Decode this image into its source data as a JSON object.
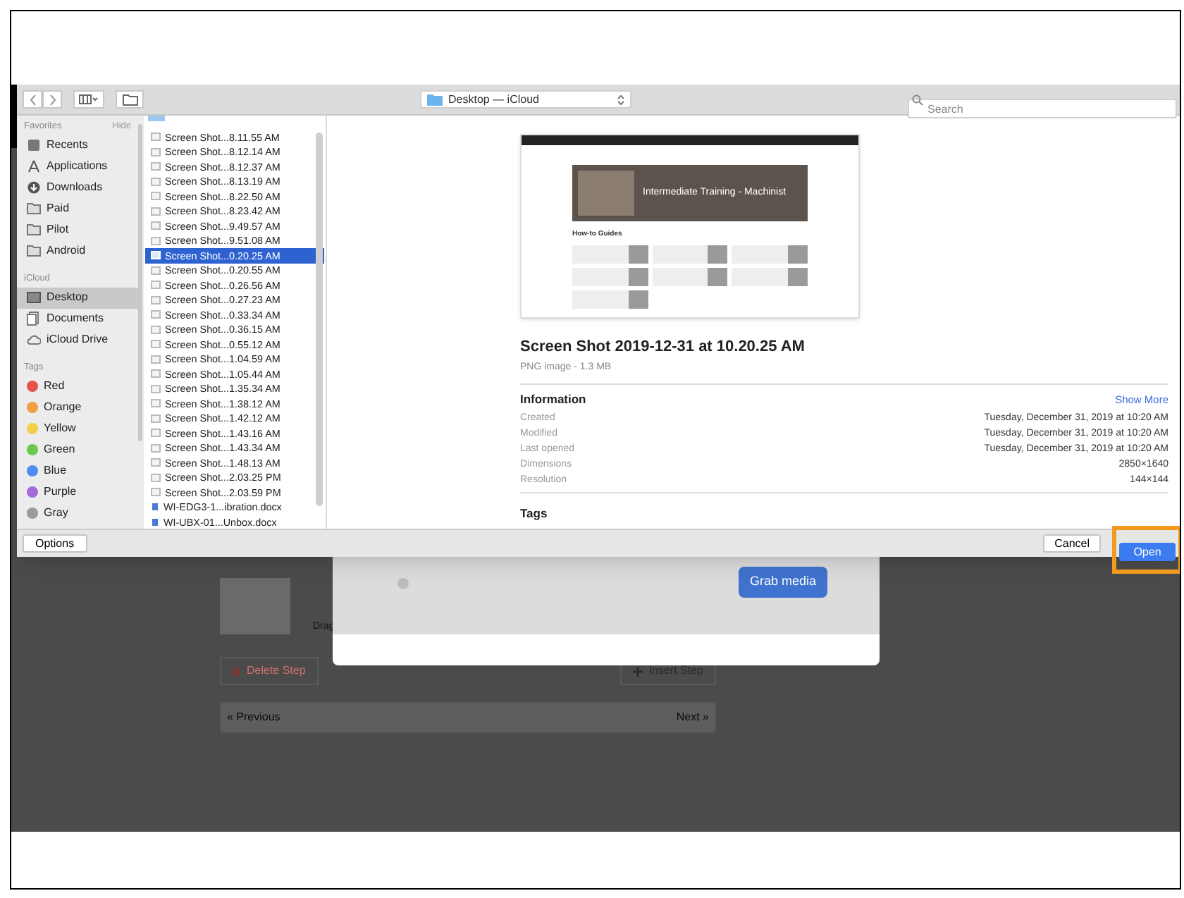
{
  "toolbar": {
    "location": "Desktop — iCloud",
    "search": {
      "placeholder": "Search"
    }
  },
  "sidebar": {
    "sections": [
      {
        "title": "Favorites",
        "action": "Hide",
        "items": [
          {
            "label": "Recents",
            "selected": false
          },
          {
            "label": "Applications",
            "selected": false
          },
          {
            "label": "Downloads",
            "selected": false
          },
          {
            "label": "Paid",
            "selected": false
          },
          {
            "label": "Pilot",
            "selected": false
          },
          {
            "label": "Android",
            "selected": false
          }
        ]
      },
      {
        "title": "iCloud",
        "items": [
          {
            "label": "Desktop",
            "selected": true
          },
          {
            "label": "Documents",
            "selected": false
          },
          {
            "label": "iCloud Drive",
            "selected": false
          }
        ]
      },
      {
        "title": "Tags",
        "items": [
          {
            "label": "Red",
            "color": "#e5534b",
            "selected": false
          },
          {
            "label": "Orange",
            "color": "#f0a040",
            "selected": false
          },
          {
            "label": "Yellow",
            "color": "#f2d04a",
            "selected": false
          },
          {
            "label": "Green",
            "color": "#6cc94f",
            "selected": false
          },
          {
            "label": "Blue",
            "color": "#4f8cf5",
            "selected": false
          },
          {
            "label": "Purple",
            "color": "#a66ad8",
            "selected": false
          },
          {
            "label": "Gray",
            "color": "#9a9a9a",
            "selected": false
          }
        ]
      }
    ]
  },
  "files": [
    {
      "name": "Screen Shot...8.11.55 AM",
      "kind": "image",
      "selected": false
    },
    {
      "name": "Screen Shot...8.12.14 AM",
      "kind": "image",
      "selected": false
    },
    {
      "name": "Screen Shot...8.12.37 AM",
      "kind": "image",
      "selected": false
    },
    {
      "name": "Screen Shot...8.13.19 AM",
      "kind": "image",
      "selected": false
    },
    {
      "name": "Screen Shot...8.22.50 AM",
      "kind": "image",
      "selected": false
    },
    {
      "name": "Screen Shot...8.23.42 AM",
      "kind": "image",
      "selected": false
    },
    {
      "name": "Screen Shot...9.49.57 AM",
      "kind": "image",
      "selected": false
    },
    {
      "name": "Screen Shot...9.51.08 AM",
      "kind": "image",
      "selected": false
    },
    {
      "name": "Screen Shot...0.20.25 AM",
      "kind": "image",
      "selected": true
    },
    {
      "name": "Screen Shot...0.20.55 AM",
      "kind": "image",
      "selected": false
    },
    {
      "name": "Screen Shot...0.26.56 AM",
      "kind": "image",
      "selected": false
    },
    {
      "name": "Screen Shot...0.27.23 AM",
      "kind": "image",
      "selected": false
    },
    {
      "name": "Screen Shot...0.33.34 AM",
      "kind": "image",
      "selected": false
    },
    {
      "name": "Screen Shot...0.36.15 AM",
      "kind": "image",
      "selected": false
    },
    {
      "name": "Screen Shot...0.55.12 AM",
      "kind": "image",
      "selected": false
    },
    {
      "name": "Screen Shot...1.04.59 AM",
      "kind": "image",
      "selected": false
    },
    {
      "name": "Screen Shot...1.05.44 AM",
      "kind": "image",
      "selected": false
    },
    {
      "name": "Screen Shot...1.35.34 AM",
      "kind": "image",
      "selected": false
    },
    {
      "name": "Screen Shot...1.38.12 AM",
      "kind": "image",
      "selected": false
    },
    {
      "name": "Screen Shot...1.42.12 AM",
      "kind": "image",
      "selected": false
    },
    {
      "name": "Screen Shot...1.43.16 AM",
      "kind": "image",
      "selected": false
    },
    {
      "name": "Screen Shot...1.43.34 AM",
      "kind": "image",
      "selected": false
    },
    {
      "name": "Screen Shot...1.48.13 AM",
      "kind": "image",
      "selected": false
    },
    {
      "name": "Screen Shot...2.03.25 PM",
      "kind": "image",
      "selected": false
    },
    {
      "name": "Screen Shot...2.03.59 PM",
      "kind": "image",
      "selected": false
    },
    {
      "name": "WI-EDG3-1...ibration.docx",
      "kind": "document",
      "selected": false
    },
    {
      "name": "WI-UBX-01...Unbox.docx",
      "kind": "document",
      "selected": false
    }
  ],
  "preview": {
    "thumbnail": {
      "banner_title": "Intermediate Training - Machinist",
      "section_title": "How-to Guides"
    },
    "title": "Screen Shot 2019-12-31 at 10.20.25 AM",
    "subtitle": "PNG image - 1.3 MB",
    "info_heading": "Information",
    "show_more": "Show More",
    "info": [
      {
        "label": "Created",
        "value": "Tuesday, December 31, 2019 at 10:20 AM"
      },
      {
        "label": "Modified",
        "value": "Tuesday, December 31, 2019 at 10:20 AM"
      },
      {
        "label": "Last opened",
        "value": "Tuesday, December 31, 2019 at 10:20 AM"
      },
      {
        "label": "Dimensions",
        "value": "2850×1640"
      },
      {
        "label": "Resolution",
        "value": "144×144"
      }
    ],
    "tags_heading": "Tags"
  },
  "buttons": {
    "options": "Options",
    "cancel": "Cancel",
    "open": "Open"
  },
  "background_page": {
    "drag_hint": "Drag",
    "delete_step": "Delete Step",
    "insert_step": "Insert Step",
    "previous": "« Previous",
    "next": "Next »",
    "modal_button": "Grab media"
  }
}
